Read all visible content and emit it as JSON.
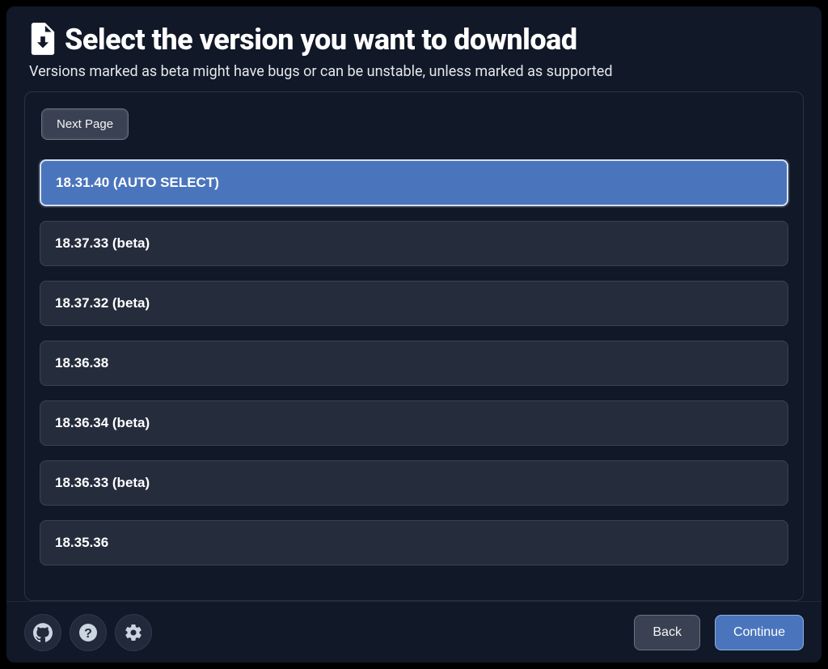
{
  "header": {
    "title": "Select the version you want to download",
    "subtitle": "Versions marked as beta might have bugs or can be unstable, unless marked as supported"
  },
  "controls": {
    "next_page": "Next Page"
  },
  "versions": [
    {
      "label": "18.31.40 (AUTO SELECT)",
      "selected": true
    },
    {
      "label": "18.37.33 (beta)",
      "selected": false
    },
    {
      "label": "18.37.32 (beta)",
      "selected": false
    },
    {
      "label": "18.36.38",
      "selected": false
    },
    {
      "label": "18.36.34 (beta)",
      "selected": false
    },
    {
      "label": "18.36.33 (beta)",
      "selected": false
    },
    {
      "label": "18.35.36",
      "selected": false
    }
  ],
  "footer": {
    "back": "Back",
    "continue": "Continue"
  },
  "icons": {
    "download_doc": "download-file-icon",
    "github": "github-icon",
    "help": "help-icon",
    "settings": "gear-icon"
  }
}
